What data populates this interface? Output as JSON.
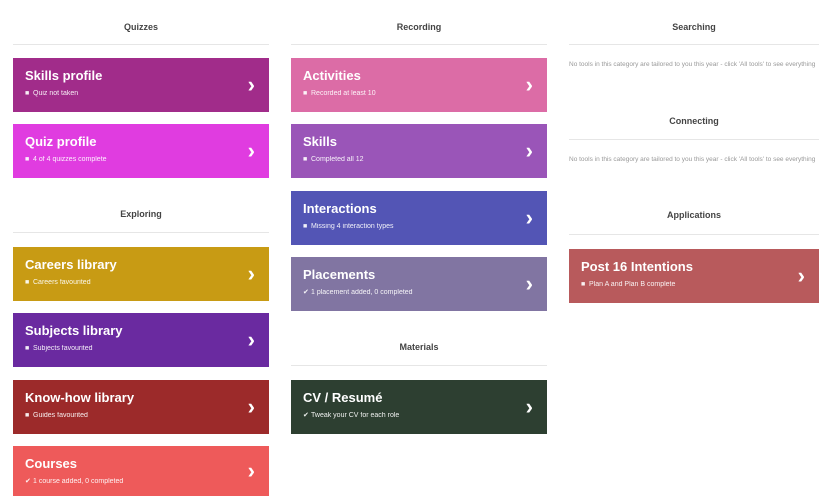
{
  "quizzes": {
    "title": "Quizzes",
    "skills_profile": {
      "title": "Skills profile",
      "status": "Quiz not taken",
      "mark": "■",
      "color": "#a12c8a"
    },
    "quiz_profile": {
      "title": "Quiz profile",
      "status": "4 of 4 quizzes complete",
      "mark": "■",
      "color": "#e03ce0"
    }
  },
  "exploring": {
    "title": "Exploring",
    "careers": {
      "title": "Careers library",
      "status": "Careers favourited",
      "mark": "■",
      "color": "#c89b14"
    },
    "subjects": {
      "title": "Subjects library",
      "status": "Subjects favourited",
      "mark": "■",
      "color": "#6a2aa0"
    },
    "knowhow": {
      "title": "Know-how library",
      "status": "Guides favourited",
      "mark": "■",
      "color": "#9c2a2a"
    },
    "courses": {
      "title": "Courses",
      "status": "1 course added, 0 completed",
      "mark": "✔",
      "color": "#ee5a5a"
    }
  },
  "recording": {
    "title": "Recording",
    "activities": {
      "title": "Activities",
      "status": "Recorded at least 10",
      "mark": "■",
      "color": "#dc6ca6"
    },
    "skills": {
      "title": "Skills",
      "status": "Completed all 12",
      "mark": "■",
      "color": "#9a55b8"
    },
    "interactions": {
      "title": "Interactions",
      "status": "Missing 4 interaction types",
      "mark": "■",
      "color": "#5355b5"
    },
    "placements": {
      "title": "Placements",
      "status": "1 placement added, 0 completed",
      "mark": "✔",
      "color": "#8175a2"
    }
  },
  "materials": {
    "title": "Materials",
    "cv": {
      "title": "CV / Resumé",
      "status": "Tweak your CV for each role",
      "mark": "✔",
      "color": "#2d3f31"
    }
  },
  "searching": {
    "title": "Searching",
    "note": "No tools in this category are tailored to you this year - click 'All tools' to see everything"
  },
  "connecting": {
    "title": "Connecting",
    "note": "No tools in this category are tailored to you this year - click 'All tools' to see everything"
  },
  "applications": {
    "title": "Applications",
    "post16": {
      "title": "Post 16 Intentions",
      "status": "Plan A and Plan B complete",
      "mark": "■",
      "color": "#b85a5c"
    }
  },
  "icons": {
    "chevron": "chevron-right-icon"
  }
}
